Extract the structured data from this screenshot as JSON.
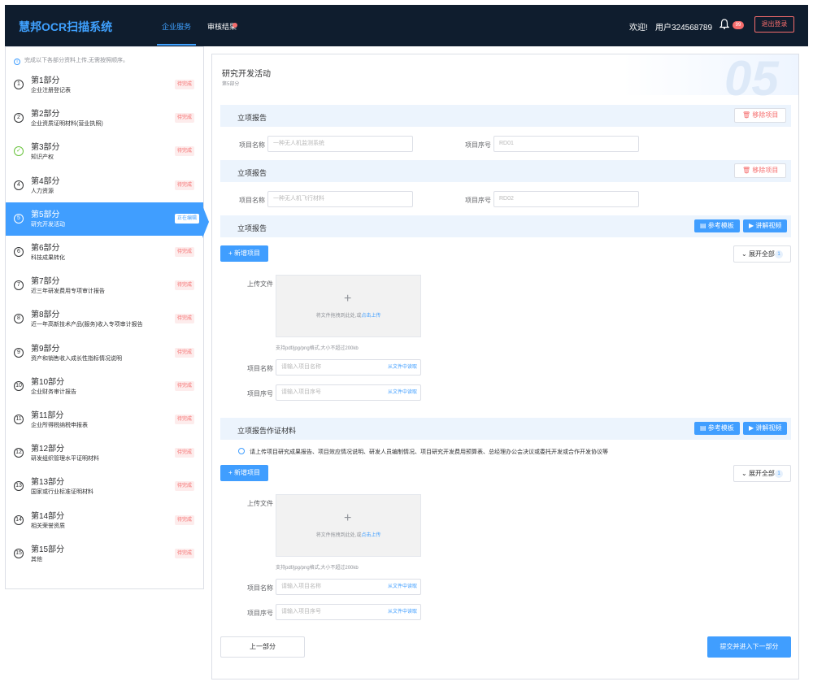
{
  "topbar": {
    "logo": "慧邦OCR扫描系统",
    "nav": [
      "企业服务",
      "审核结果"
    ],
    "welcome": "欢迎!",
    "user": "用户324568789",
    "notif_count": "99",
    "logout": "退出登录"
  },
  "sidebar": {
    "tip": "完成以下各部分资料上传,无需按照顺序。",
    "items": [
      {
        "num": "1",
        "title": "第1部分",
        "sub": "企业注册登记表",
        "tag": "待完成"
      },
      {
        "num": "2",
        "title": "第2部分",
        "sub": "企业资质证明材料(营业执照)",
        "tag": "待完成"
      },
      {
        "num": "✓",
        "title": "第3部分",
        "sub": "知识产权",
        "tag": "待完成"
      },
      {
        "num": "4",
        "title": "第4部分",
        "sub": "人力资源",
        "tag": "待完成"
      },
      {
        "num": "5",
        "title": "第5部分",
        "sub": "研究开发活动",
        "tag": "正在编辑"
      },
      {
        "num": "6",
        "title": "第6部分",
        "sub": "科技成果转化",
        "tag": "待完成"
      },
      {
        "num": "7",
        "title": "第7部分",
        "sub": "近三年研发费用专项审计报告",
        "tag": "待完成"
      },
      {
        "num": "8",
        "title": "第8部分",
        "sub": "近一年高新技术产品(服务)收入专项审计报告",
        "tag": "待完成"
      },
      {
        "num": "9",
        "title": "第9部分",
        "sub": "资产和销售收入成长性指标情况说明",
        "tag": "待完成"
      },
      {
        "num": "10",
        "title": "第10部分",
        "sub": "企业财务审计报告",
        "tag": "待完成"
      },
      {
        "num": "11",
        "title": "第11部分",
        "sub": "企业所得税纳税申报表",
        "tag": "待完成"
      },
      {
        "num": "12",
        "title": "第12部分",
        "sub": "研发组织管理水平证明材料",
        "tag": "待完成"
      },
      {
        "num": "13",
        "title": "第13部分",
        "sub": "国家或行业标准证明材料",
        "tag": "待完成"
      },
      {
        "num": "14",
        "title": "第14部分",
        "sub": "相关荣誉资质",
        "tag": "待完成"
      },
      {
        "num": "15",
        "title": "第15部分",
        "sub": "其他",
        "tag": "待完成"
      }
    ]
  },
  "main": {
    "title": "研究开发活动",
    "subtitle": "第5部分",
    "big_number": "05",
    "sections": [
      {
        "title": "立项报告",
        "remove": "移除项目",
        "name_label": "项目名称",
        "name_value": "一种无人机监测系统",
        "code_label": "项目序号",
        "code_value": "RD01"
      },
      {
        "title": "立项报告",
        "remove": "移除项目",
        "name_label": "项目名称",
        "name_value": "一种无人机飞行材料",
        "code_label": "项目序号",
        "code_value": "RD02"
      }
    ],
    "section3": {
      "title": "立项报告",
      "btn_template": "参考模板",
      "btn_video": "讲解视频"
    },
    "add_label": "新增项目",
    "expand_label": "展开全部",
    "expand_count": "1",
    "upload": {
      "label": "上传文件",
      "text": "将文件拖拽到此处,或",
      "link": "点击上传",
      "hint": "支持pdf/jpg/png格式,大小不超过200kb",
      "name_label": "项目名称",
      "name_placeholder": "请输入项目名称",
      "code_label": "项目序号",
      "code_placeholder": "请输入项目序号",
      "read_label": "从文件中读取"
    },
    "section4": {
      "title": "立项报告作证材料",
      "btn_template": "参考模板",
      "btn_video": "讲解视频",
      "note": "请上传项目研究成果报告、项目效应情况说明、研发人员编制情况、项目研究开发费用预算表、总经理办公会决议或委托开发或合作开发协议等"
    },
    "prev": "上一部分",
    "next": "提交并进入下一部分"
  }
}
